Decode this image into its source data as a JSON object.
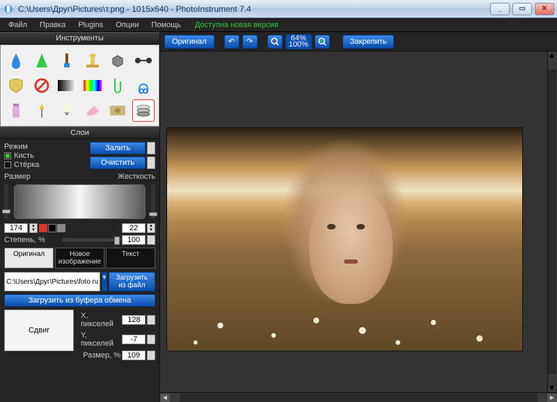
{
  "window": {
    "title": "C:\\Users\\Друг\\Pictures\\т.png - 1015x640 - PhotoInstrument 7.4"
  },
  "menu": {
    "file": "Файл",
    "edit": "Правка",
    "plugins": "Plugins",
    "options": "Опции",
    "help": "Помощь",
    "update": "Доступна новая версия"
  },
  "panels": {
    "tools": "Инструменты",
    "layers": "Слои"
  },
  "mode": {
    "label": "Режим",
    "brush": "Кисть",
    "eraser": "Стёрка"
  },
  "buttons": {
    "fill": "Залить",
    "clear": "Очистить",
    "load_file": "Загрузить из файл",
    "load_clipboard": "Загрузить из буфера обмена",
    "original": "Оригинал",
    "pin": "Закрепить"
  },
  "labels": {
    "size": "Размер",
    "hardness": "Жесткость",
    "opacity": "Степень, %",
    "shift": "Сдвиг",
    "x_px": "X, пикселей",
    "y_px": "Y, пикселей",
    "size_pct": "Размер, %"
  },
  "values": {
    "size": "174",
    "hardness": "22",
    "opacity": "100",
    "x": "128",
    "y": "-7",
    "size_pct": "109",
    "zoom_top": "64%",
    "zoom_bot": "100%"
  },
  "tabs": {
    "original": "Оригинал",
    "new_image": "Новое изображение",
    "text": "Текст"
  },
  "path": {
    "value": "C:\\Users\\Друг\\Pictures\\foto na"
  },
  "tool_icons": [
    "drop",
    "cone",
    "brush",
    "stamp",
    "cube",
    "barbell",
    "shield",
    "nored",
    "grad-bw",
    "grad-rainbow",
    "clip-g",
    "clip-b",
    "jar",
    "pin-y",
    "bulb",
    "eraser",
    "money",
    "layers"
  ],
  "colors": {
    "red": "#d43a2f",
    "black": "#000",
    "gray": "#888"
  }
}
